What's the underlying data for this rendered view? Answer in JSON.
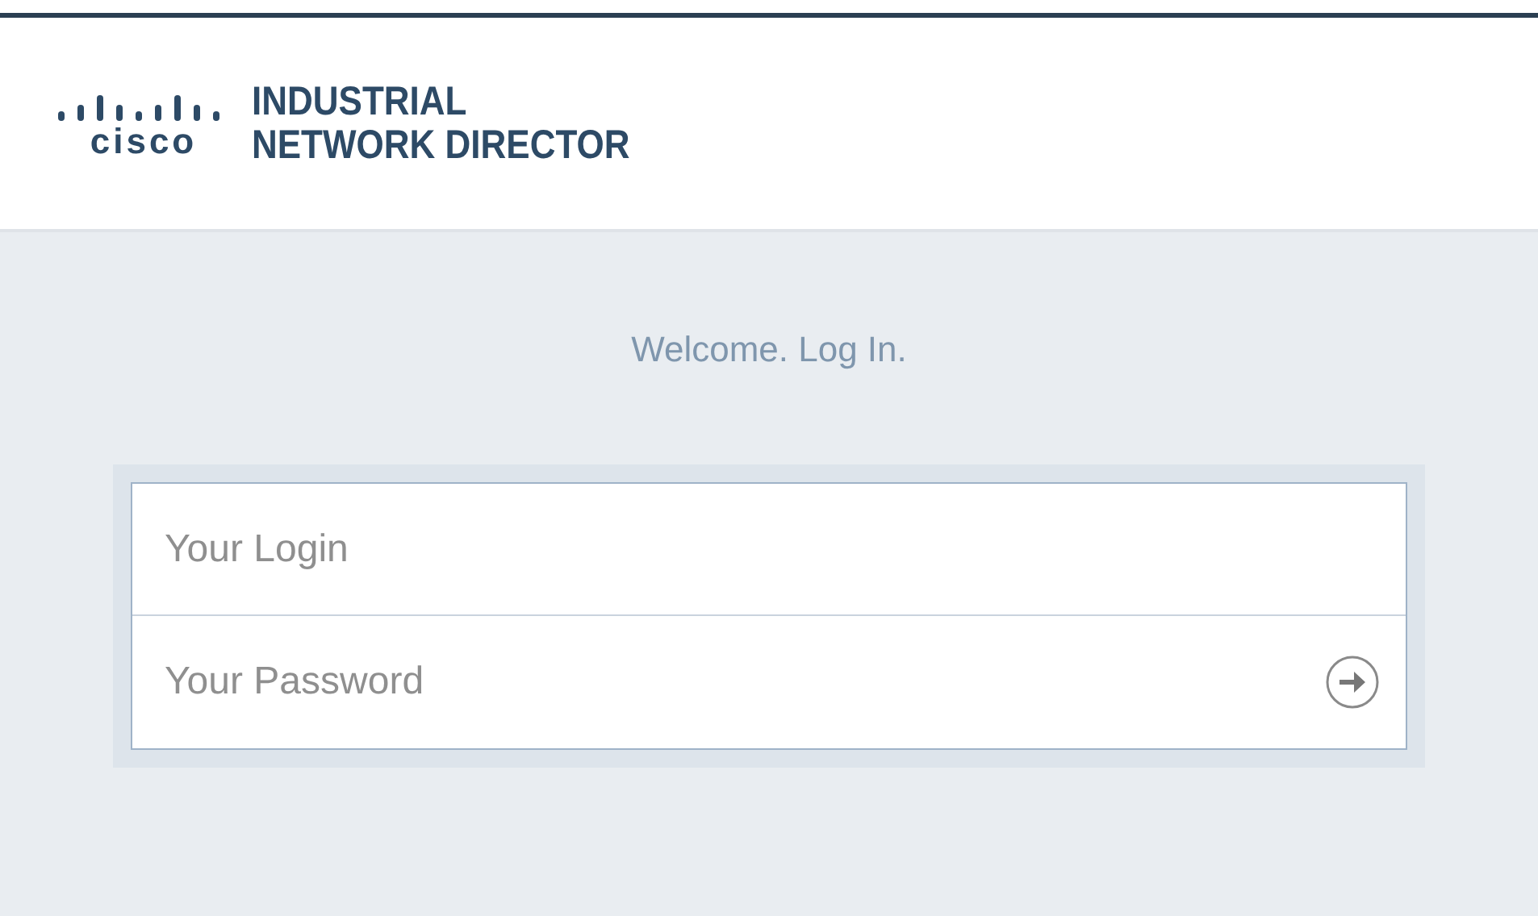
{
  "header": {
    "logo_wordmark": "cisco",
    "product_name": [
      "INDUSTRIAL",
      "NETWORK DIRECTOR"
    ]
  },
  "login": {
    "heading": "Welcome. Log In.",
    "fields": [
      {
        "kind": "text",
        "placeholder": "Your Login"
      },
      {
        "kind": "password",
        "placeholder": "Your Password"
      }
    ]
  }
}
